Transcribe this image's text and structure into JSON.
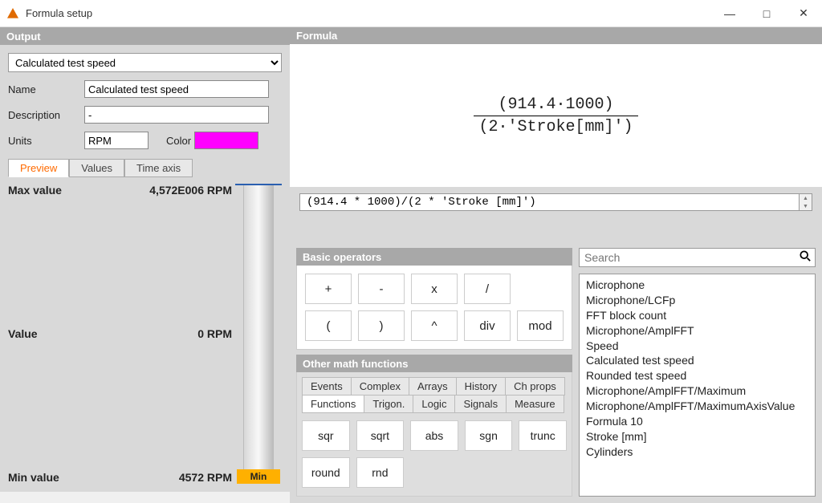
{
  "window": {
    "title": "Formula setup",
    "minimize": "—",
    "maximize": "□",
    "close": "✕"
  },
  "panels": {
    "output": "Output",
    "formula": "Formula"
  },
  "output": {
    "combo_selected": "Calculated test speed",
    "name_label": "Name",
    "name_value": "Calculated test speed",
    "desc_label": "Description",
    "desc_value": "-",
    "units_label": "Units",
    "units_value": "RPM",
    "color_label": "Color",
    "color_value": "#ff00ff",
    "tabs": {
      "preview": "Preview",
      "values": "Values",
      "timeaxis": "Time axis"
    },
    "preview": {
      "max_label": "Max value",
      "max_value": "4,572E006 RPM",
      "value_label": "Value",
      "value_value": "0 RPM",
      "min_label": "Min value",
      "min_value": "4572 RPM",
      "min_tag": "Min"
    }
  },
  "formula": {
    "render_top": "(914.4·1000)",
    "render_bottom": "(2·'Stroke[mm]')",
    "raw": "(914.4 * 1000)/(2 * 'Stroke [mm]')"
  },
  "operators": {
    "header": "Basic operators",
    "row1": [
      "+",
      "-",
      "x",
      "/"
    ],
    "row2": [
      "(",
      ")",
      "^",
      "div",
      "mod"
    ]
  },
  "functions": {
    "header": "Other math functions",
    "tabs_top": [
      "Events",
      "Complex",
      "Arrays",
      "History",
      "Ch props"
    ],
    "tabs_bottom": [
      "Functions",
      "Trigon.",
      "Logic",
      "Signals",
      "Measure"
    ],
    "active_tab": "Functions",
    "buttons": [
      "sqr",
      "sqrt",
      "abs",
      "sgn",
      "trunc",
      "round",
      "rnd"
    ]
  },
  "search": {
    "placeholder": "Search"
  },
  "channels": [
    "Microphone",
    "Microphone/LCFp",
    "FFT block count",
    "Microphone/AmplFFT",
    "Speed",
    "Calculated test speed",
    "Rounded test speed",
    "Microphone/AmplFFT/Maximum",
    "Microphone/AmplFFT/MaximumAxisValue",
    "Formula 10",
    "Stroke [mm]",
    "Cylinders"
  ]
}
